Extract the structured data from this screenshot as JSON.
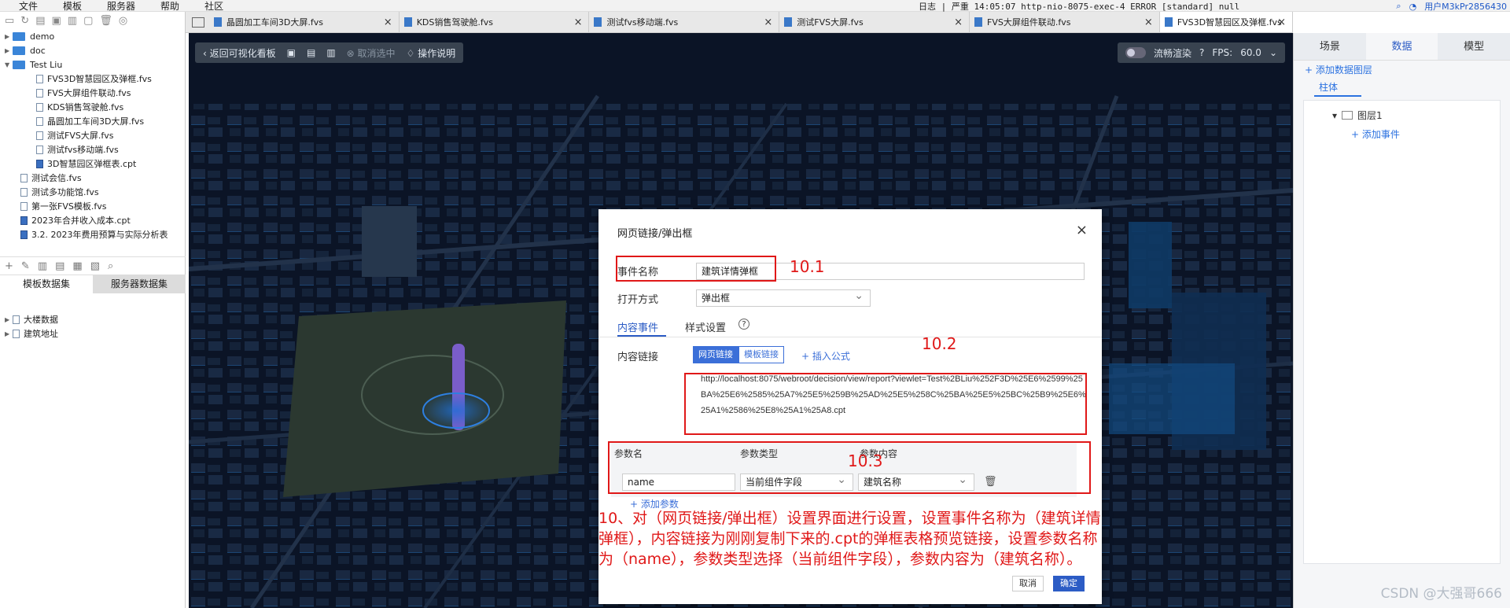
{
  "menubar": {
    "items": [
      "文件",
      "模板",
      "服务器",
      "帮助",
      "社区"
    ],
    "log_text": "日志 | 严重 14:05:07 http-nio-8075-exec-4 ERROR [standard] null",
    "user": "用户M3kPr2856430"
  },
  "left_panel": {
    "tree": [
      {
        "label": "demo",
        "type": "folder"
      },
      {
        "label": "doc",
        "type": "folder"
      },
      {
        "label": "Test Liu",
        "type": "folder"
      },
      {
        "label": "FVS3D智慧园区及弹框.fvs",
        "type": "file"
      },
      {
        "label": "FVS大屏组件联动.fvs",
        "type": "file"
      },
      {
        "label": "KDS销售驾驶舱.fvs",
        "type": "file"
      },
      {
        "label": "晶圆加工车间3D大屏.fvs",
        "type": "file"
      },
      {
        "label": "测试FVS大屏.fvs",
        "type": "file"
      },
      {
        "label": "测试fvs移动端.fvs",
        "type": "file"
      },
      {
        "label": "3D智慧园区弹框表.cpt",
        "type": "cpt"
      },
      {
        "label": "测试会信.fvs",
        "type": "file"
      },
      {
        "label": "测试多功能馆.fvs",
        "type": "file"
      },
      {
        "label": "第一张FVS模板.fvs",
        "type": "file"
      },
      {
        "label": "2023年合并收入成本.cpt",
        "type": "cpt"
      },
      {
        "label": "3.2. 2023年费用预算与实际分析表",
        "type": "cpt"
      }
    ],
    "dataset_tabs": [
      "模板数据集",
      "服务器数据集"
    ],
    "datasets": [
      "大楼数据",
      "建筑地址"
    ]
  },
  "tabs": [
    {
      "label": "晶圆加工车间3D大屏.fvs"
    },
    {
      "label": "KDS销售驾驶舱.fvs"
    },
    {
      "label": "测试fvs移动端.fvs"
    },
    {
      "label": "测试FVS大屏.fvs"
    },
    {
      "label": "FVS大屏组件联动.fvs"
    },
    {
      "label": "FVS3D智慧园区及弹框.fvs"
    }
  ],
  "canvas_toolbar": {
    "back": "返回可视化看板",
    "deselect": "取消选中",
    "help": "操作说明",
    "render": "流畅渲染",
    "fps_label": "FPS:",
    "fps_value": "60.0"
  },
  "right_panel": {
    "tabs": [
      "场景",
      "数据",
      "模型"
    ],
    "add_layer": "+ 添加数据图层",
    "sub_tab": "柱体",
    "layer": "图层1",
    "add_event": "+ 添加事件"
  },
  "dialog": {
    "title": "网页链接/弹出框",
    "event_name_label": "事件名称",
    "event_name_value": "建筑详情弹框",
    "open_mode_label": "打开方式",
    "open_mode_value": "弹出框",
    "tab_content": "内容事件",
    "tab_style": "样式设置",
    "content_link_label": "内容链接",
    "seg_web": "网页链接",
    "seg_template": "模板链接",
    "insert_formula": "+ 插入公式",
    "url": "http://localhost:8075/webroot/decision/view/report?viewlet=Test%2BLiu%252F3D%25E6%2599%25BA%25E6%2585%25A7%25E5%259B%25AD%25E5%258C%25BA%25E5%25BC%25B9%25E6%25A1%2586%25E8%25A1%25A8.cpt",
    "param_headers": [
      "参数名",
      "参数类型",
      "参数内容"
    ],
    "param_name": "name",
    "param_type": "当前组件字段",
    "param_content": "建筑名称",
    "add_param": "+ 添加参数",
    "cancel": "取消",
    "confirm": "确定"
  },
  "annotations": {
    "n1": "10.1",
    "n2": "10.2",
    "n3": "10.3",
    "text": "10、对（网页链接/弹出框）设置界面进行设置，设置事件名称为（建筑详情弹框），内容链接为刚刚复制下来的.cpt的弹框表格预览链接，设置参数名称为（name），参数类型选择（当前组件字段），参数内容为（建筑名称）。"
  },
  "watermark": "CSDN @大强哥666"
}
